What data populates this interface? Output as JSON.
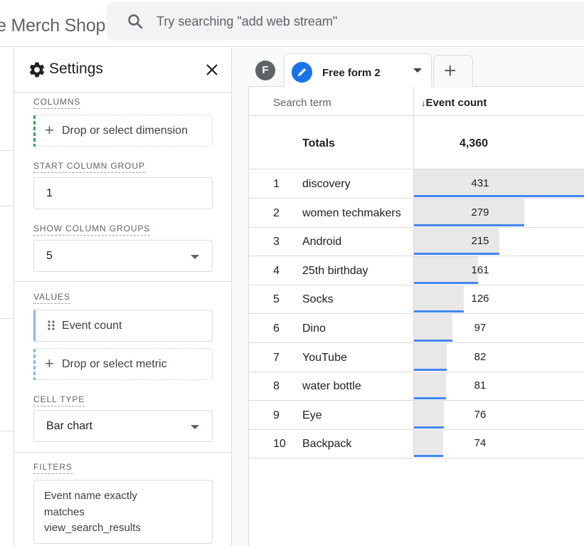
{
  "app": {
    "title": "e Merch Shop"
  },
  "search": {
    "placeholder": "Try searching \"add web stream\""
  },
  "settings": {
    "title": "Settings",
    "columns_label": "COLUMNS",
    "drop_dimension": "Drop or select dimension",
    "start_column_group_label": "START COLUMN GROUP",
    "start_column_group_value": "1",
    "show_column_groups_label": "SHOW COLUMN GROUPS",
    "show_column_groups_value": "5",
    "values_label": "VALUES",
    "value_chip": "Event count",
    "drop_metric": "Drop or select metric",
    "cell_type_label": "CELL TYPE",
    "cell_type_value": "Bar chart",
    "filters_label": "FILTERS",
    "filter_line1": "Event name exactly",
    "filter_line2": "matches",
    "filter_line3": "view_search_results"
  },
  "tabs": {
    "first_badge": "F",
    "active_label": "Free form 2",
    "add_label": "+"
  },
  "table": {
    "col_dimension": "Search term",
    "col_metric": "Event count",
    "sort_arrow": "↓",
    "totals_label": "Totals",
    "totals_value": "4,360",
    "max_value": 431,
    "rows": [
      {
        "rank": "1",
        "term": "discovery",
        "value": 431
      },
      {
        "rank": "2",
        "term": "women techmakers",
        "value": 279
      },
      {
        "rank": "3",
        "term": "Android",
        "value": 215
      },
      {
        "rank": "4",
        "term": "25th birthday",
        "value": 161
      },
      {
        "rank": "5",
        "term": "Socks",
        "value": 126
      },
      {
        "rank": "6",
        "term": "Dino",
        "value": 97
      },
      {
        "rank": "7",
        "term": "YouTube",
        "value": 82
      },
      {
        "rank": "8",
        "term": "water bottle",
        "value": 81
      },
      {
        "rank": "9",
        "term": "Eye",
        "value": 76
      },
      {
        "rank": "10",
        "term": "Backpack",
        "value": 74
      }
    ]
  },
  "colors": {
    "accent": "#1a73e8",
    "bar_line": "#4285f4",
    "bar_fill": "#e8e8e8",
    "columns_zone": "#34a853",
    "values_zone": "#8ab4f8"
  }
}
